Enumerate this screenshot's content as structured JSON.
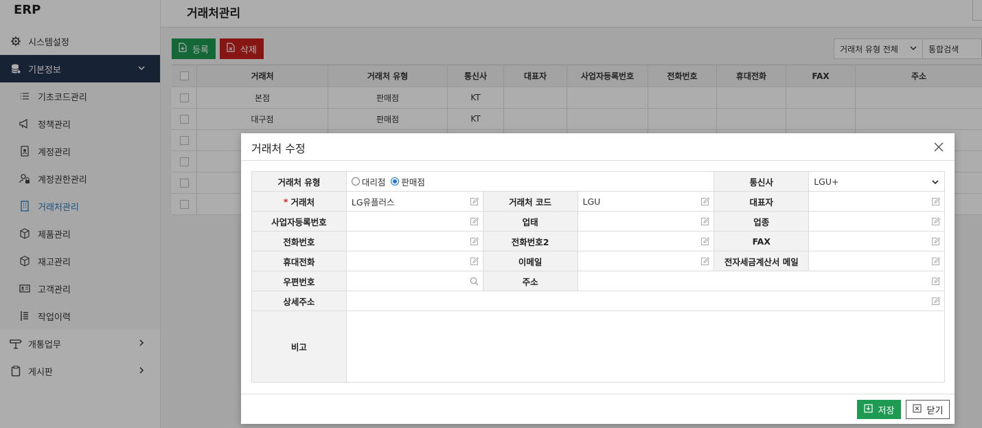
{
  "app": {
    "logo": "ERP"
  },
  "sidebar": {
    "items": [
      {
        "label": "시스템설정",
        "icon": "gear-icon"
      },
      {
        "label": "기본정보",
        "icon": "database-icon"
      },
      {
        "label": "개통업무",
        "icon": "signpost-icon"
      },
      {
        "label": "게시판",
        "icon": "clipboard-icon"
      }
    ],
    "sub_items": [
      {
        "label": "기초코드관리",
        "icon": "list-icon"
      },
      {
        "label": "정책관리",
        "icon": "megaphone-icon"
      },
      {
        "label": "계정관리",
        "icon": "id-card-icon"
      },
      {
        "label": "계정권한관리",
        "icon": "user-lock-icon"
      },
      {
        "label": "거래처관리",
        "icon": "building-icon"
      },
      {
        "label": "제품관리",
        "icon": "box-icon"
      },
      {
        "label": "재고관리",
        "icon": "box-icon"
      },
      {
        "label": "고객관리",
        "icon": "contact-card-icon"
      },
      {
        "label": "작업이력",
        "icon": "history-icon"
      }
    ]
  },
  "header": {
    "title": "거래처관리"
  },
  "toolbar": {
    "register": "등록",
    "delete": "삭제"
  },
  "filter": {
    "type_select": "거래처 유형 전체",
    "search_placeholder": "통합검색"
  },
  "grid": {
    "columns": [
      "거래처",
      "거래처 유형",
      "통신사",
      "대표자",
      "사업자등록번호",
      "전화번호",
      "휴대전화",
      "FAX",
      "주소"
    ],
    "rows": [
      [
        "본점",
        "판매점",
        "KT",
        "",
        "",
        "",
        "",
        "",
        ""
      ],
      [
        "대구점",
        "판매점",
        "KT",
        "",
        "",
        "",
        "",
        "",
        ""
      ],
      [
        "",
        "",
        "",
        "",
        "",
        "",
        "",
        "",
        ""
      ],
      [
        "",
        "",
        "",
        "",
        "",
        "",
        "",
        "",
        ""
      ],
      [
        "",
        "",
        "",
        "",
        "",
        "",
        "",
        "",
        ""
      ],
      [
        "",
        "",
        "",
        "",
        "",
        "",
        "",
        "",
        ""
      ]
    ]
  },
  "modal": {
    "title": "거래처 수정",
    "labels": {
      "type": "거래처 유형",
      "carrier": "통신사",
      "name": "거래처",
      "code": "거래처 코드",
      "ceo": "대표자",
      "biz_no": "사업자등록번호",
      "biz_type": "업태",
      "biz_item": "업종",
      "phone": "전화번호",
      "phone2": "전화번호2",
      "fax": "FAX",
      "mobile": "휴대전화",
      "email": "이메일",
      "tax_email": "전자세금계산서 메일",
      "zip": "우편번호",
      "address": "주소",
      "address_detail": "상세주소",
      "memo": "비고"
    },
    "required_mark": "*",
    "type_options": [
      "대리점",
      "판매점"
    ],
    "type_selected": "판매점",
    "values": {
      "carrier": "LGU+",
      "name": "LG유플러스",
      "code": "LGU",
      "ceo": "",
      "biz_no": "",
      "biz_type": "",
      "biz_item": "",
      "phone": "",
      "phone2": "",
      "fax": "",
      "mobile": "",
      "email": "",
      "tax_email": "",
      "zip": "",
      "address": "",
      "address_detail": "",
      "memo": ""
    },
    "save": "저장",
    "close": "닫기"
  },
  "colors": {
    "sidebar_active": "#23344e",
    "green": "#1e9a52",
    "red": "#c8201e",
    "link_blue": "#2a7bbf"
  }
}
